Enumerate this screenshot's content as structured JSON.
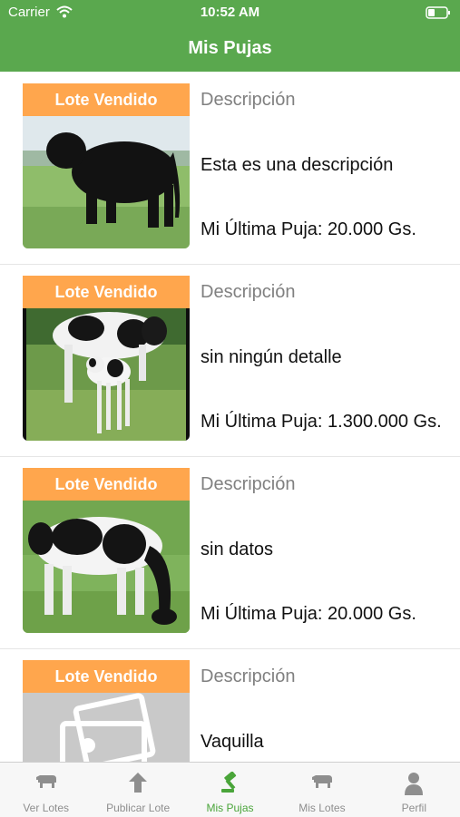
{
  "status_bar": {
    "carrier": "Carrier",
    "time": "10:52 AM"
  },
  "header": {
    "title": "Mis Pujas"
  },
  "bids": [
    {
      "badge": "Lote Vendido",
      "description_label": "Descripción",
      "description": "Esta es una descripción",
      "last_bid": "Mi Última Puja: 20.000 Gs.",
      "image": "black-bull"
    },
    {
      "badge": "Lote Vendido",
      "description_label": "Descripción",
      "description": "sin ningún detalle",
      "last_bid": "Mi Última Puja: 1.300.000 Gs.",
      "image": "cow-with-calf"
    },
    {
      "badge": "Lote Vendido",
      "description_label": "Descripción",
      "description": "sin datos",
      "last_bid": "Mi Última Puja: 20.000 Gs.",
      "image": "grazing-cow"
    },
    {
      "badge": "Lote Vendido",
      "description_label": "Descripción",
      "description": "Vaquilla",
      "last_bid": "",
      "image": "placeholder-photo"
    }
  ],
  "tab_bar": {
    "items": [
      {
        "label": "Ver Lotes",
        "icon": "cow-icon"
      },
      {
        "label": "Publicar Lote",
        "icon": "upload-arrow-icon"
      },
      {
        "label": "Mis Pujas",
        "icon": "gavel-icon"
      },
      {
        "label": "Mis Lotes",
        "icon": "cow-icon"
      },
      {
        "label": "Perfil",
        "icon": "person-icon"
      }
    ],
    "active_index": 2
  },
  "colors": {
    "brand_green": "#5aa84e",
    "badge_orange": "#ffa64d",
    "active_tab": "#4aa53a"
  }
}
